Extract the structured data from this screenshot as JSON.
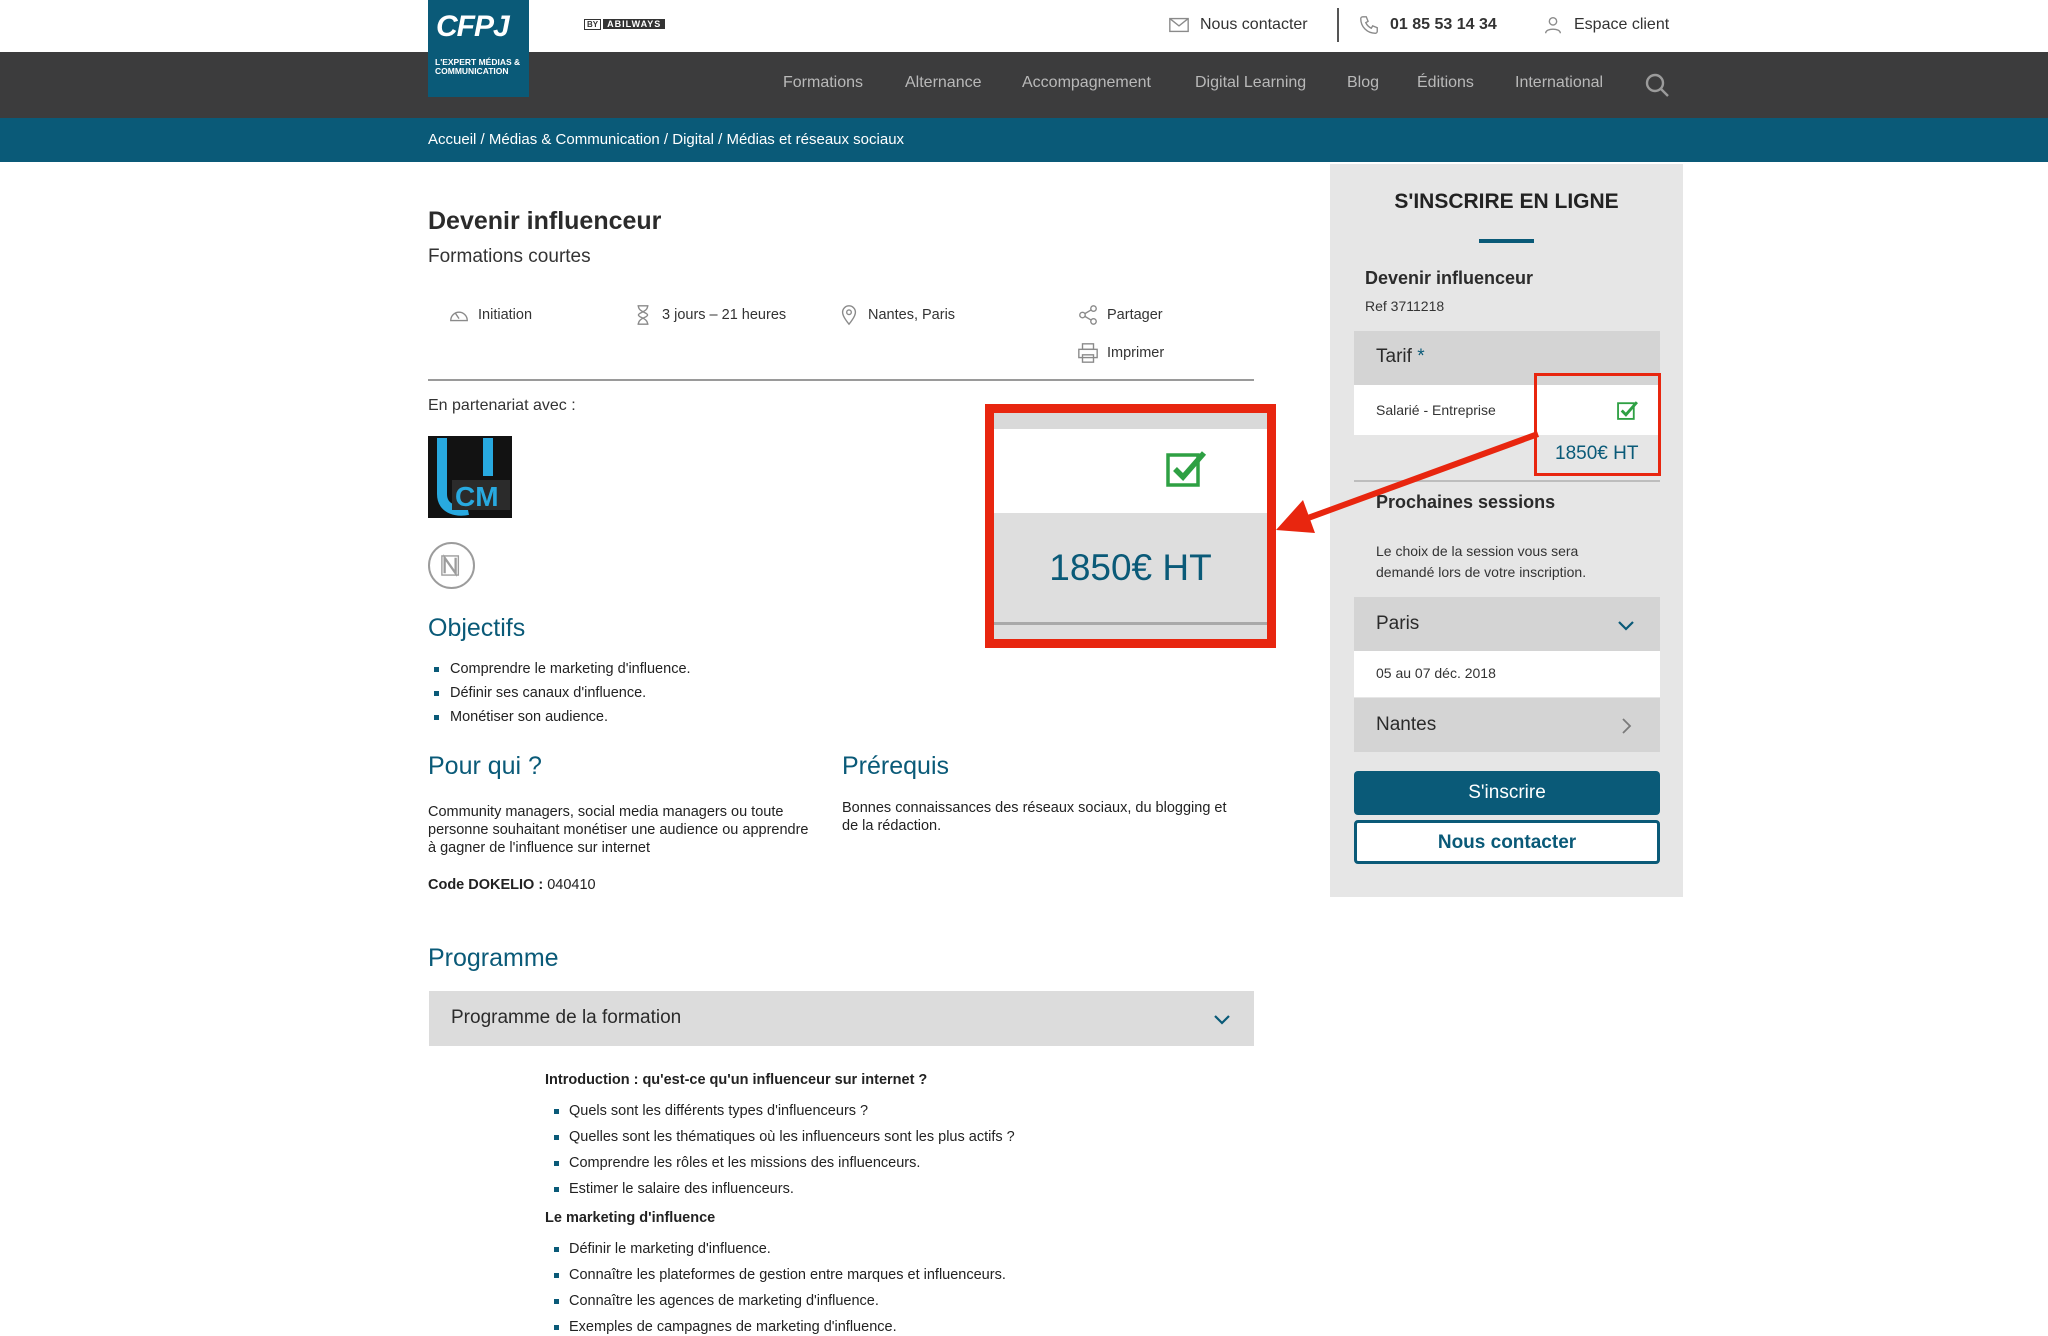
{
  "brand": {
    "logo_text": "CFPJ",
    "logo_subtitle": "L'EXPERT MÉDIAS & COMMUNICATION",
    "by_label": "BY",
    "group_label": "ABILWAYS"
  },
  "topbar": {
    "contact_label": "Nous contacter",
    "phone_label": "01 85 53 14 34",
    "client_label": "Espace client"
  },
  "nav": {
    "items": [
      "Formations",
      "Alternance",
      "Accompagnement",
      "Digital Learning",
      "Blog",
      "Éditions",
      "International"
    ]
  },
  "breadcrumb": {
    "text": "Accueil / Médias & Communication / Digital / Médias et réseaux sociaux"
  },
  "course": {
    "title": "Devenir influenceur",
    "subtitle": "Formations courtes",
    "level": "Initiation",
    "duration": "3 jours – 21 heures",
    "location": "Nantes, Paris",
    "share_label": "Partager",
    "print_label": "Imprimer",
    "partner_label": "En partenariat avec :"
  },
  "objectives": {
    "heading": "Objectifs",
    "items": [
      "Comprendre le marketing d'influence.",
      "Définir ses canaux d'influence.",
      "Monétiser son audience."
    ]
  },
  "audience": {
    "heading": "Pour qui ?",
    "text": "Community managers, social media managers ou toute personne souhaitant monétiser une audience ou apprendre à gagner de l'influence sur internet"
  },
  "prerequisites": {
    "heading": "Prérequis",
    "text": "Bonnes connaissances des réseaux sociaux, du blogging et de la rédaction."
  },
  "dokelio": {
    "label": "Code DOKELIO :",
    "value": "040410"
  },
  "programme": {
    "heading": "Programme",
    "accordion_label": "Programme de la formation",
    "sections": [
      {
        "title": "Introduction : qu'est-ce qu'un influenceur sur internet ?",
        "items": [
          "Quels sont les différents types d'influenceurs ?",
          "Quelles sont les thématiques où les influenceurs sont les plus actifs ?",
          "Comprendre les rôles et les missions des influenceurs.",
          "Estimer le salaire des influenceurs."
        ]
      },
      {
        "title": "Le marketing d'influence",
        "items": [
          "Définir le marketing d'influence.",
          "Connaître les plateformes de gestion entre marques et influenceurs.",
          "Connaître les agences de marketing d'influence.",
          "Exemples de campagnes de marketing d'influence."
        ]
      }
    ]
  },
  "callout": {
    "price": "1850€ HT"
  },
  "sidebar": {
    "title": "S'INSCRIRE EN LIGNE",
    "course": "Devenir influenceur",
    "ref": "Ref 3711218",
    "tarif_label": "Tarif",
    "tarif_required": "*",
    "tarif_option": "Salarié - Entreprise",
    "price": "1850€ HT",
    "sessions_title": "Prochaines sessions",
    "sessions_note": "Le choix de la session vous sera demandé lors de votre inscription.",
    "city_open": "Paris",
    "city_open_date": "05 au 07 déc. 2018",
    "city_closed": "Nantes",
    "register_label": "S'inscrire",
    "contact_label": "Nous contacter"
  },
  "colors": {
    "brand_blue": "#0a5a78",
    "nav_dark": "#3c3c3d",
    "highlight_red": "#e8260f",
    "check_green": "#2ea043"
  }
}
